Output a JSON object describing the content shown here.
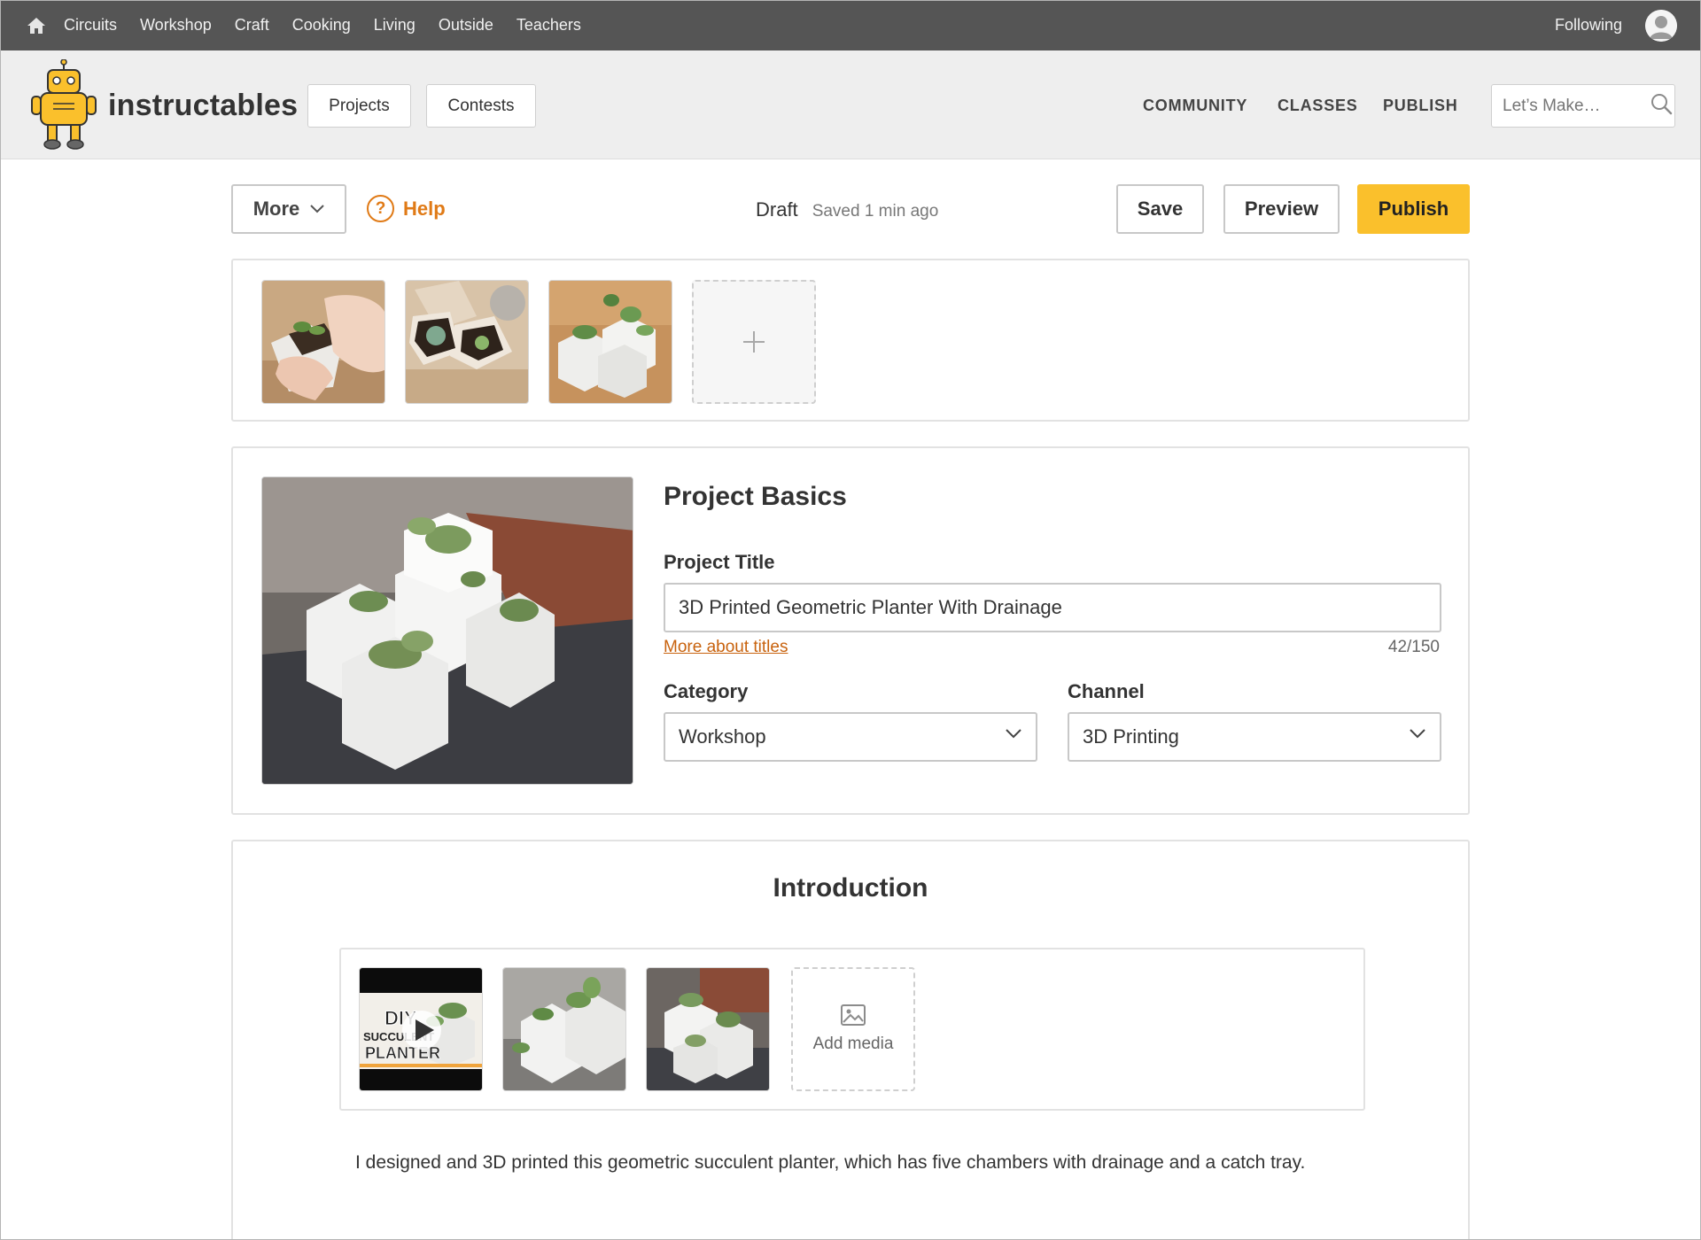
{
  "topnav": {
    "categories": [
      "Circuits",
      "Workshop",
      "Craft",
      "Cooking",
      "Living",
      "Outside",
      "Teachers"
    ],
    "following": "Following"
  },
  "header": {
    "logo_text": "instructables",
    "projects_label": "Projects",
    "contests_label": "Contests",
    "links": [
      "COMMUNITY",
      "CLASSES",
      "PUBLISH"
    ],
    "search_placeholder": "Let’s Make…"
  },
  "toolbar": {
    "more_label": "More",
    "help_label": "Help",
    "status": "Draft",
    "saved": "Saved 1 min ago",
    "save_label": "Save",
    "preview_label": "Preview",
    "publish_label": "Publish"
  },
  "basics": {
    "heading": "Project Basics",
    "title_label": "Project Title",
    "title_value": "3D Printed Geometric Planter With Drainage",
    "titles_link": "More about titles",
    "counter": "42/150",
    "category_label": "Category",
    "category_value": "Workshop",
    "channel_label": "Channel",
    "channel_value": "3D Printing"
  },
  "intro": {
    "heading": "Introduction",
    "video_caption": [
      "DIY",
      "SUCCULENT",
      "PLANTER"
    ],
    "add_media": "Add media",
    "text": "I designed and 3D printed this geometric succulent planter, which has five chambers with drainage and a catch tray."
  },
  "colors": {
    "accent": "#fac02c",
    "link": "#c8620d",
    "topnav_bg": "#555555",
    "header_bg": "#eeeeee"
  }
}
